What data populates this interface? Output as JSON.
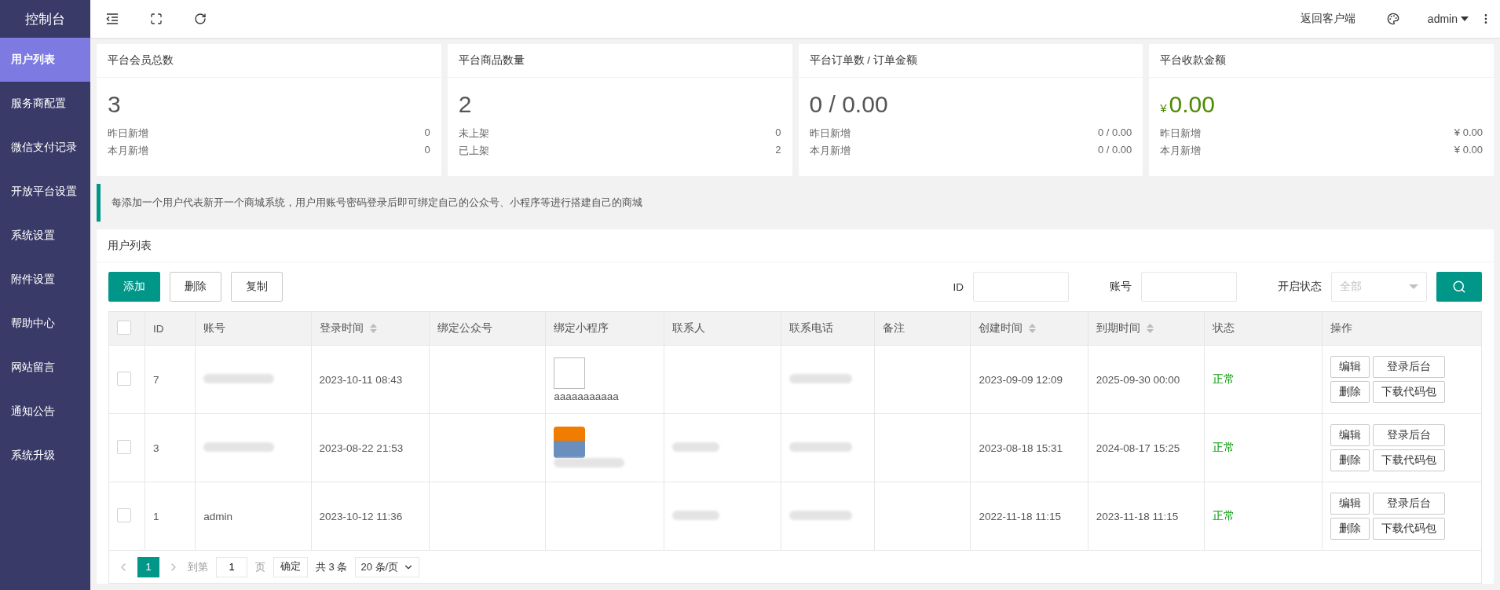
{
  "sidebar": {
    "title": "控制台",
    "items": [
      {
        "label": "用户列表",
        "selected": true
      },
      {
        "label": "服务商配置",
        "selected": false
      },
      {
        "label": "微信支付记录",
        "selected": false
      },
      {
        "label": "开放平台设置",
        "selected": false
      },
      {
        "label": "系统设置",
        "selected": false
      },
      {
        "label": "附件设置",
        "selected": false
      },
      {
        "label": "帮助中心",
        "selected": false
      },
      {
        "label": "网站留言",
        "selected": false
      },
      {
        "label": "通知公告",
        "selected": false
      },
      {
        "label": "系统升级",
        "selected": false
      }
    ]
  },
  "topbar": {
    "client_link": "返回客户端",
    "user": "admin"
  },
  "stat_cards": [
    {
      "title": "平台会员总数",
      "value": "3",
      "rows": [
        {
          "label": "昨日新增",
          "value": "0"
        },
        {
          "label": "本月新增",
          "value": "0"
        }
      ]
    },
    {
      "title": "平台商品数量",
      "value": "2",
      "rows": [
        {
          "label": "未上架",
          "value": "0"
        },
        {
          "label": "已上架",
          "value": "2"
        }
      ]
    },
    {
      "title": "平台订单数 / 订单金额",
      "value": "0 / 0.00",
      "rows": [
        {
          "label": "昨日新增",
          "value": "0 / 0.00"
        },
        {
          "label": "本月新增",
          "value": "0 / 0.00"
        }
      ]
    },
    {
      "title": "平台收款金额",
      "value": "0.00",
      "currency": "¥",
      "rows": [
        {
          "label": "昨日新增",
          "value": "¥ 0.00"
        },
        {
          "label": "本月新增",
          "value": "¥ 0.00"
        }
      ]
    }
  ],
  "notice": "每添加一个用户代表新开一个商城系统，用户用账号密码登录后即可绑定自己的公众号、小程序等进行搭建自己的商城",
  "panel_title": "用户列表",
  "toolbar": {
    "buttons": [
      {
        "label": "添加",
        "primary": true
      },
      {
        "label": "删除",
        "primary": false
      },
      {
        "label": "复制",
        "primary": false
      }
    ],
    "filters": [
      {
        "label": "ID",
        "kind": "input"
      },
      {
        "label": "账号",
        "kind": "input"
      },
      {
        "label": "开启状态",
        "kind": "select",
        "placeholder": "全部"
      }
    ]
  },
  "table": {
    "select_all_checked": false,
    "columns": [
      {
        "label": "ID",
        "sortable": false
      },
      {
        "label": "账号",
        "sortable": false
      },
      {
        "label": "登录时间",
        "sortable": true
      },
      {
        "label": "绑定公众号",
        "sortable": false
      },
      {
        "label": "绑定小程序",
        "sortable": false
      },
      {
        "label": "联系人",
        "sortable": false
      },
      {
        "label": "联系电话",
        "sortable": false
      },
      {
        "label": "备注",
        "sortable": false
      },
      {
        "label": "创建时间",
        "sortable": true
      },
      {
        "label": "到期时间",
        "sortable": true
      },
      {
        "label": "状态",
        "sortable": false
      },
      {
        "label": "操作",
        "sortable": false
      }
    ],
    "rows": [
      {
        "checked": false,
        "id": "7",
        "account": {
          "kind": "redacted"
        },
        "login_time": "2023-10-11 08:43",
        "mini_program": {
          "kind": "broken_image",
          "caption": "aaaaaaaaaaa"
        },
        "contact": {
          "kind": "empty"
        },
        "phone": {
          "kind": "redacted"
        },
        "created": "2023-09-09 12:09",
        "expires": "2025-09-30 00:00",
        "status": "正常",
        "actions": [
          "编辑",
          "登录后台",
          "删除",
          "下载代码包"
        ]
      },
      {
        "checked": false,
        "id": "3",
        "account": {
          "kind": "redacted"
        },
        "login_time": "2023-08-22 21:53",
        "mini_program": {
          "kind": "app_icon"
        },
        "contact": {
          "kind": "redacted"
        },
        "phone": {
          "kind": "redacted"
        },
        "created": "2023-08-18 15:31",
        "expires": "2024-08-17 15:25",
        "status": "正常",
        "actions": [
          "编辑",
          "登录后台",
          "删除",
          "下载代码包"
        ]
      },
      {
        "checked": false,
        "id": "1",
        "account": {
          "kind": "text",
          "text": "admin"
        },
        "login_time": "2023-10-12 11:36",
        "mini_program": {
          "kind": "empty"
        },
        "contact": {
          "kind": "redacted"
        },
        "phone": {
          "kind": "redacted"
        },
        "created": "2022-11-18 11:15",
        "expires": "2023-11-18 11:15",
        "status": "正常",
        "actions": [
          "编辑",
          "登录后台",
          "删除",
          "下载代码包"
        ]
      }
    ]
  },
  "pagination": {
    "pages": [
      {
        "label": "1",
        "selected": true
      }
    ],
    "goto_label": "到第",
    "goto_value": "1",
    "page_unit": "页",
    "confirm": "确定",
    "total": "共 3 条",
    "page_size": "20 条/页"
  }
}
